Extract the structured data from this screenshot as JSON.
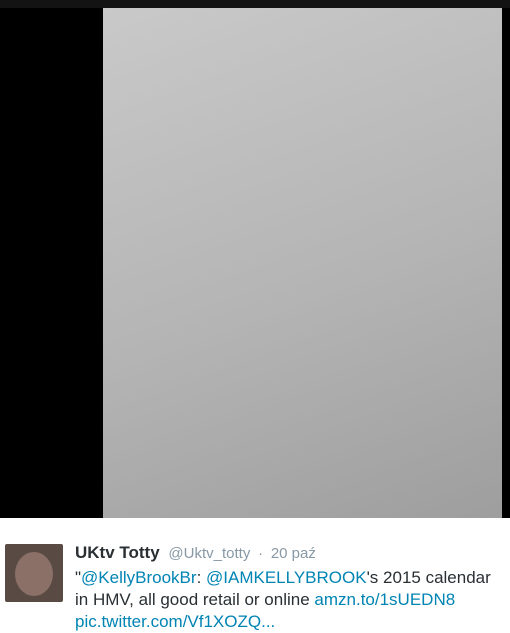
{
  "tweet": {
    "display_name": "UKtv Totty",
    "screen_name": "@Uktv_totty",
    "separator": "·",
    "timestamp": "20 paź",
    "text": {
      "open_quote": "\"",
      "mention1": "@KellyBrookBr",
      "colon": ": ",
      "mention2": "@IAMKELLYBROOK",
      "after_mention2": "'s 2015 calendar",
      "line2_prefix": "in HMV, all good retail or online ",
      "link1": "amzn.to/1sUEDN8",
      "pic_link": "pic.twitter.com/Vf1XOZQ..."
    }
  },
  "colors": {
    "link": "#0084b4",
    "text": "#292f33",
    "meta": "#8899a6"
  }
}
